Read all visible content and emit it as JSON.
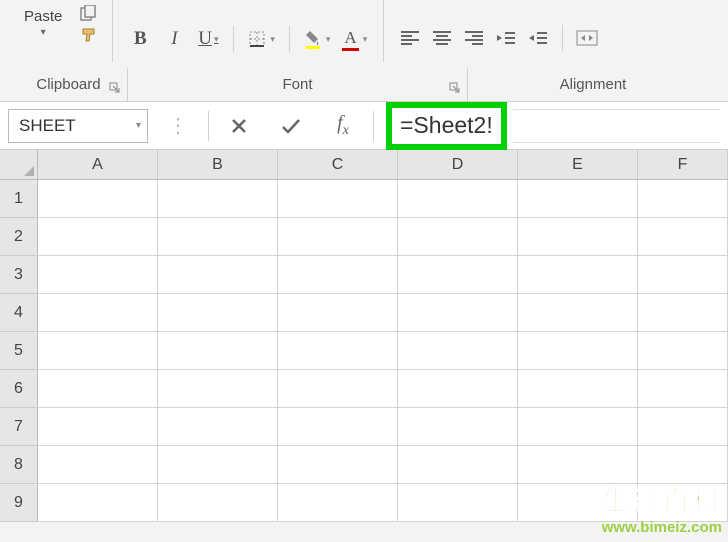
{
  "ribbon": {
    "clipboard": {
      "paste_label": "Paste",
      "group_label": "Clipboard"
    },
    "font": {
      "bold": "B",
      "italic": "I",
      "underline": "U",
      "fontcolor_letter": "A",
      "group_label": "Font"
    },
    "alignment": {
      "group_label": "Alignment"
    }
  },
  "formula_bar": {
    "name_box_value": "SHEET",
    "formula_value": "=Sheet2!"
  },
  "grid": {
    "columns": [
      "A",
      "B",
      "C",
      "D",
      "E",
      "F"
    ],
    "rows": [
      "1",
      "2",
      "3",
      "4",
      "5",
      "6",
      "7",
      "8",
      "9"
    ]
  },
  "watermark": {
    "cn": "生活百科",
    "url": "www.bimeiz.com"
  }
}
